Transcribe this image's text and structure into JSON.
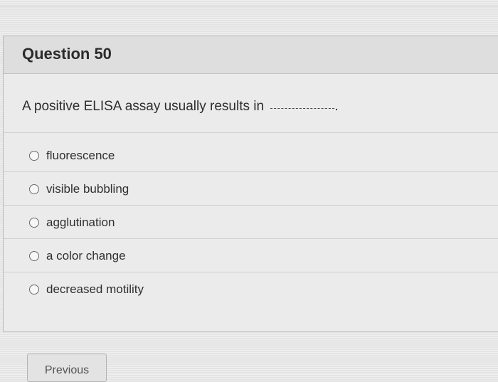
{
  "question": {
    "title": "Question 50",
    "prompt": "A positive ELISA assay usually results in",
    "blank_suffix": "."
  },
  "options": [
    {
      "label": "fluorescence"
    },
    {
      "label": "visible bubbling"
    },
    {
      "label": "agglutination"
    },
    {
      "label": "a color change"
    },
    {
      "label": "decreased motility"
    }
  ],
  "navigation": {
    "previous_label": "Previous"
  }
}
